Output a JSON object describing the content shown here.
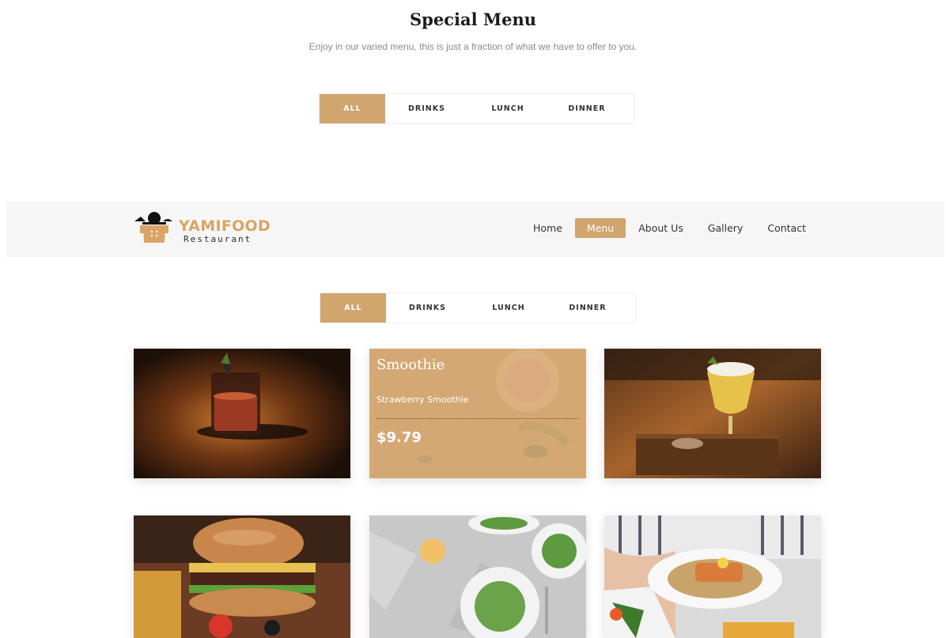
{
  "section": {
    "title": "Special Menu",
    "subtitle": "Enjoy in our varied menu, this is just a fraction of what we have to offer to you."
  },
  "filters": {
    "tabs": [
      "ALL",
      "DRINKS",
      "LUNCH",
      "DINNER"
    ],
    "active": "ALL"
  },
  "nav": {
    "logo_name": "YAMIFOOD",
    "logo_sub": "Restaurant",
    "items": [
      "Home",
      "Menu",
      "About Us",
      "Gallery",
      "Contact"
    ],
    "active": "Menu"
  },
  "featured": {
    "title": "Smoothie",
    "description": "Strawberry Smoothie",
    "price": "$9.79"
  },
  "cards": [
    {
      "icon": "cocktail-whiskey-image"
    },
    {
      "icon": "smoothie-card"
    },
    {
      "icon": "cocktail-beer-image"
    },
    {
      "icon": "burger-image"
    },
    {
      "icon": "salad-image"
    },
    {
      "icon": "salmon-dinner-image"
    }
  ],
  "colors": {
    "accent": "#d0a56e",
    "nav_bg": "#f6f6f7",
    "text_dark": "#1c1c1c",
    "text_muted": "#8a8a8a"
  }
}
